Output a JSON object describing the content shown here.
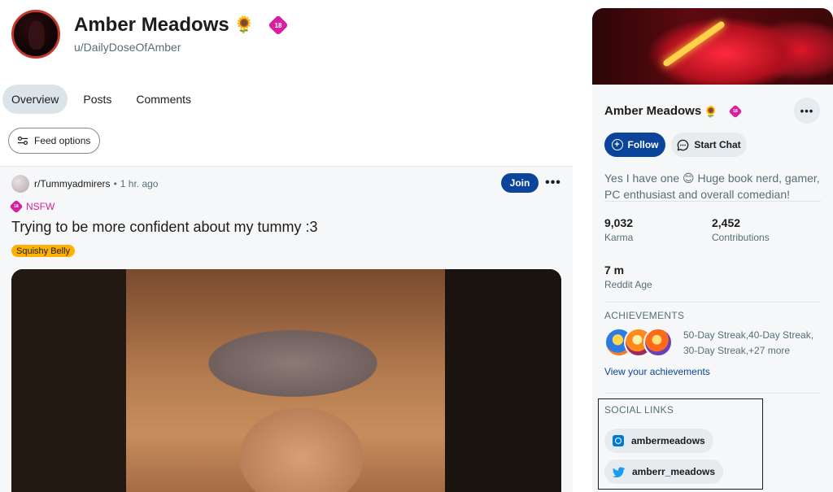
{
  "profile": {
    "name": "Amber Meadows",
    "emoji": "🌻",
    "nsfw_badge": "18",
    "handle": "u/DailyDoseOfAmber"
  },
  "tabs": [
    {
      "label": "Overview",
      "active": true
    },
    {
      "label": "Posts",
      "active": false
    },
    {
      "label": "Comments",
      "active": false
    }
  ],
  "feed_options_label": "Feed options",
  "post": {
    "subreddit": "r/Tummyadmirers",
    "separator": "•",
    "age": "1 hr. ago",
    "join_label": "Join",
    "more_label": "•••",
    "nsfw_label": "NSFW",
    "nsfw_badge": "18",
    "title": "Trying to be more confident about my tummy :3",
    "flair": "Squishy Belly",
    "flair_color": "#ffb000"
  },
  "sidebar": {
    "name": "Amber Meadows",
    "emoji": "🌻",
    "nsfw_badge": "18",
    "more_label": "•••",
    "follow_label": "Follow",
    "follow_icon": "+",
    "chat_label": "Start Chat",
    "bio": "Yes I have one 😊 Huge book nerd, gamer, PC enthusiast and overall comedian!",
    "stats": [
      {
        "value": "9,032",
        "label": "Karma"
      },
      {
        "value": "2,452",
        "label": "Contributions"
      },
      {
        "value": "7 m",
        "label": "Reddit Age"
      }
    ],
    "achievements_title": "ACHIEVEMENTS",
    "achievements_text": "50-Day Streak,40-Day Streak, 30-Day Streak,+27 more",
    "achievements_link": "View your achievements",
    "social_title": "SOCIAL LINKS",
    "social_links": [
      {
        "icon": "instagram-icon",
        "label": "ambermeadows"
      },
      {
        "icon": "twitter-icon",
        "label": "amberr_meadows"
      }
    ],
    "accent_color": "#0a449b"
  }
}
